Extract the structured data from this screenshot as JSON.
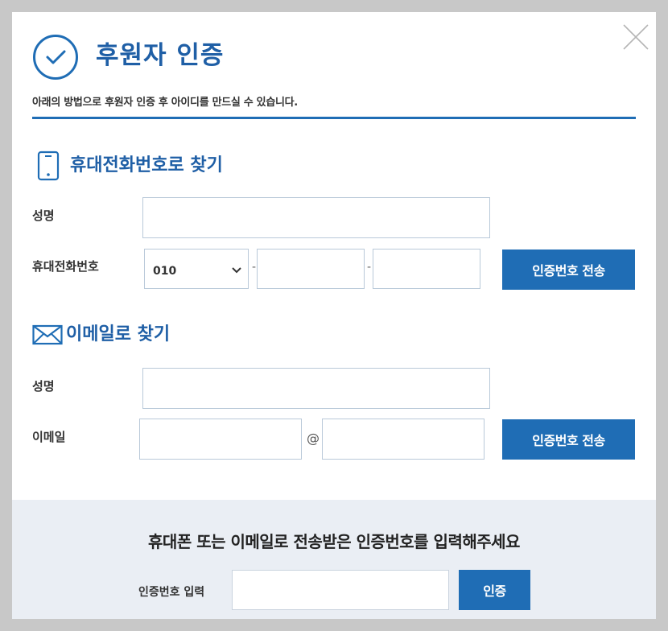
{
  "modal": {
    "title": "후원자 인증",
    "description": "아래의 방법으로 후원자 인증 후 아이디를 만드실 수 있습니다."
  },
  "phone_section": {
    "title": "휴대전화번호로 찾기",
    "name_label": "성명",
    "name_value": "",
    "phone_label": "휴대전화번호",
    "prefix_selected": "010",
    "separator": "-",
    "mid_value": "",
    "last_value": "",
    "send_button": "인증번호 전송"
  },
  "email_section": {
    "title": "이메일로 찾기",
    "name_label": "성명",
    "name_value": "",
    "email_label": "이메일",
    "email_user": "",
    "at_sign": "@",
    "email_domain": "",
    "send_button": "인증번호 전송"
  },
  "verify": {
    "message": "휴대폰 또는 이메일로 전송받은 인증번호를 입력해주세요",
    "code_label": "인증번호 입력",
    "code_value": "",
    "confirm_button": "인증"
  },
  "colors": {
    "accent": "#1f5fa6",
    "button": "#1f6db5",
    "bottom_bg": "#eaeef4",
    "overlay": "#c8c8c8"
  }
}
